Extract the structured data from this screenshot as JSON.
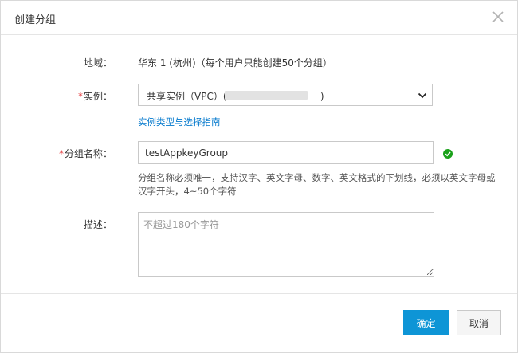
{
  "dialog": {
    "title": "创建分组"
  },
  "form": {
    "region": {
      "label": "地域：",
      "value": "华东 1 (杭州)（每个用户只能创建50个分组）"
    },
    "instance": {
      "required_mark": "*",
      "label": "实例：",
      "selected_prefix": "共享实例（VPC）(a",
      "selected_suffix": ")",
      "link": "实例类型与选择指南"
    },
    "group_name": {
      "required_mark": "*",
      "label": "分组名称：",
      "value": "testAppkeyGroup",
      "help": "分组名称必须唯一，支持汉字、英文字母、数字、英文格式的下划线，必须以英文字母或汉字开头，4~50个字符"
    },
    "description": {
      "label": "描述：",
      "placeholder": "不超过180个字符"
    }
  },
  "footer": {
    "confirm_label": "确定",
    "cancel_label": "取消"
  },
  "colors": {
    "primary": "#0e95d6",
    "link": "#0077cc",
    "required": "#e4393c",
    "success": "#1aa11a"
  }
}
